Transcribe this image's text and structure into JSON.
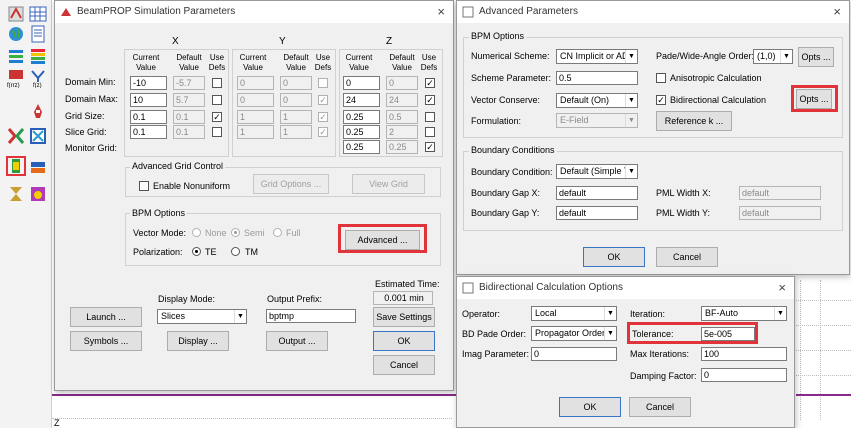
{
  "main": {
    "title": "BeamPROP Simulation Parameters",
    "close": "×",
    "axes": [
      "X",
      "Y",
      "Z"
    ],
    "col_headers": {
      "current": "Current Value",
      "default": "Default Value",
      "use": "Use Defs"
    },
    "row_labels": [
      "Domain Min:",
      "Domain Max:",
      "Grid Size:",
      "Slice Grid:",
      "Monitor Grid:"
    ],
    "x": {
      "current": [
        "-10",
        "10",
        "0.1",
        "0.1"
      ],
      "default": [
        "-5.7",
        "5.7",
        "0.1",
        "0.1"
      ],
      "use": [
        false,
        false,
        true,
        false
      ]
    },
    "y": {
      "current": [
        "0",
        "0",
        "1",
        "1"
      ],
      "default": [
        "0",
        "0",
        "1",
        "1"
      ],
      "use": [
        false,
        true,
        true,
        true
      ]
    },
    "z": {
      "current": [
        "0",
        "24",
        "0.25",
        "0.25",
        "0.25"
      ],
      "default": [
        "0",
        "24",
        "0.5",
        "2",
        "0.25"
      ],
      "use": [
        true,
        true,
        false,
        false,
        true
      ]
    },
    "advanced_grid": {
      "title": "Advanced Grid Control",
      "enable_label": "Enable Nonuniform",
      "grid_options": "Grid Options ...",
      "view_grid": "View Grid"
    },
    "bpm": {
      "title": "BPM Options",
      "vector_label": "Vector Mode:",
      "vector_opts": [
        "None",
        "Semi",
        "Full"
      ],
      "pol_label": "Polarization:",
      "pol_opts": [
        "TE",
        "TM"
      ],
      "advanced": "Advanced ..."
    },
    "display_mode_label": "Display Mode:",
    "display_mode_value": "Slices",
    "output_prefix_label": "Output Prefix:",
    "output_prefix_value": "bptmp",
    "est_time_label": "Estimated Time:",
    "est_time_value": "0.001 min",
    "buttons": {
      "launch": "Launch ...",
      "symbols": "Symbols ...",
      "display": "Display ...",
      "output": "Output ...",
      "save": "Save Settings",
      "ok": "OK",
      "cancel": "Cancel"
    }
  },
  "advanced": {
    "title": "Advanced Parameters",
    "close": "×",
    "bpm_group": "BPM Options",
    "numerical_scheme_label": "Numerical Scheme:",
    "numerical_scheme_value": "CN Implicit or AD",
    "scheme_param_label": "Scheme Parameter:",
    "scheme_param_value": "0.5",
    "vector_conserve_label": "Vector Conserve:",
    "vector_conserve_value": "Default (On)",
    "formulation_label": "Formulation:",
    "formulation_value": "E-Field",
    "pade_label": "Pade/Wide-Angle Order:",
    "pade_value": "(1,0)",
    "opts1": "Opts ...",
    "aniso_label": "Anisotropic Calculation",
    "bidir_label": "Bidirectional Calculation",
    "opts2": "Opts ...",
    "reference_k": "Reference k ...",
    "boundary_group": "Boundary Conditions",
    "boundary_cond_label": "Boundary Condition:",
    "boundary_cond_value": "Default (Simple T",
    "gap_x_label": "Boundary Gap X:",
    "gap_x_value": "default",
    "gap_y_label": "Boundary Gap Y:",
    "gap_y_value": "default",
    "pml_x_label": "PML Width X:",
    "pml_x_value": "default",
    "pml_y_label": "PML Width Y:",
    "pml_y_value": "default",
    "ok": "OK",
    "cancel": "Cancel"
  },
  "bidir": {
    "title": "Bidirectional Calculation Options",
    "close": "×",
    "operator_label": "Operator:",
    "operator_value": "Local",
    "bd_pade_label": "BD Pade Order:",
    "bd_pade_value": "Propagator Order",
    "imag_label": "Imag Parameter:",
    "imag_value": "0",
    "iteration_label": "Iteration:",
    "iteration_value": "BF-Auto",
    "tolerance_label": "Tolerance:",
    "tolerance_value": "5e-005",
    "max_iter_label": "Max Iterations:",
    "max_iter_value": "100",
    "damping_label": "Damping Factor:",
    "damping_value": "0",
    "ok": "OK",
    "cancel": "Cancel"
  },
  "canvas": {
    "corner_label": "Z"
  },
  "colors": {
    "highlight": "#e0343a",
    "trace": "#8a2a8a"
  }
}
